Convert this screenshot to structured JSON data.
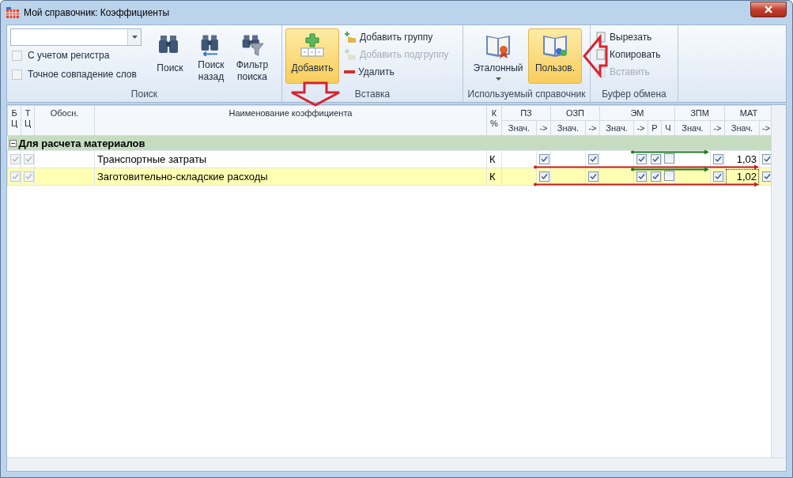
{
  "window": {
    "title": "Мой справочник: Коэффициенты"
  },
  "ribbon": {
    "search": {
      "label": "Поиск",
      "checkboxes": [
        {
          "label": "С учетом регистра",
          "checked": false
        },
        {
          "label": "Точное совпадение слов",
          "checked": false
        }
      ],
      "buttons": [
        {
          "kind": "search",
          "label": "Поиск"
        },
        {
          "kind": "back",
          "label": "Поиск назад"
        },
        {
          "kind": "filter",
          "label": "Фильтр поиска"
        }
      ]
    },
    "insert": {
      "label": "Вставка",
      "add": {
        "label": "Добавить",
        "selected": true
      },
      "items": [
        {
          "kind": "group",
          "label": "Добавить группу",
          "disabled": false
        },
        {
          "kind": "subgroup",
          "label": "Добавить подгруппу",
          "disabled": true
        },
        {
          "kind": "delete",
          "label": "Удалить",
          "disabled": false
        }
      ]
    },
    "reference": {
      "label": "Используемый справочник",
      "buttons": [
        {
          "kind": "standard",
          "label": "Эталонный",
          "selected": false,
          "dropdown": true
        },
        {
          "kind": "user",
          "label": "Пользов.",
          "selected": true,
          "dropdown": false
        }
      ]
    },
    "clipboard": {
      "label": "Буфер обмена",
      "items": [
        {
          "label": "Вырезать",
          "disabled": false
        },
        {
          "label": "Копировать",
          "disabled": false
        },
        {
          "label": "Вставить",
          "disabled": true
        }
      ]
    }
  },
  "grid": {
    "columns": [
      {
        "label": "Б Ц"
      },
      {
        "label": "Т Ц"
      },
      {
        "label": "Обосн."
      },
      {
        "label": "Наименование коэффициента"
      },
      {
        "label": "К %"
      }
    ],
    "groups": [
      {
        "label": "ПЗ",
        "sub": [
          "Знач.",
          "->"
        ]
      },
      {
        "label": "ОЗП",
        "sub": [
          "Знач.",
          "->"
        ]
      },
      {
        "label": "ЭМ",
        "sub": [
          "Знач.",
          "->",
          "Р",
          "Ч"
        ]
      },
      {
        "label": "ЗПМ",
        "sub": [
          "Знач.",
          "->"
        ]
      },
      {
        "label": "МАТ",
        "sub": [
          "Знач.",
          "->"
        ]
      }
    ],
    "sections": [
      {
        "label": "Для расчета материалов",
        "expanded": true,
        "rows": [
          {
            "selected": false,
            "bc": true,
            "tc": true,
            "name": "Транспортные затраты",
            "unit": "К",
            "cells": [
              {
                "kind": "value"
              },
              {
                "kind": "check",
                "checked": true
              },
              {
                "kind": "value"
              },
              {
                "kind": "check",
                "checked": true
              },
              {
                "kind": "value"
              },
              {
                "kind": "check",
                "checked": true
              },
              {
                "kind": "check",
                "checked": true
              },
              {
                "kind": "check",
                "checked": false
              },
              {
                "kind": "value"
              },
              {
                "kind": "check",
                "checked": true
              },
              {
                "kind": "value",
                "text": "1,03",
                "focused": false
              },
              {
                "kind": "check",
                "checked": true
              }
            ]
          },
          {
            "selected": true,
            "bc": true,
            "tc": true,
            "name": "Заготовительно-складские расходы",
            "unit": "К",
            "cells": [
              {
                "kind": "value"
              },
              {
                "kind": "check",
                "checked": true
              },
              {
                "kind": "value"
              },
              {
                "kind": "check",
                "checked": true
              },
              {
                "kind": "value"
              },
              {
                "kind": "check",
                "checked": true
              },
              {
                "kind": "check",
                "checked": true
              },
              {
                "kind": "check",
                "checked": false
              },
              {
                "kind": "value"
              },
              {
                "kind": "check",
                "checked": true
              },
              {
                "kind": "value",
                "text": "1,02",
                "focused": true
              },
              {
                "kind": "check",
                "checked": true
              }
            ]
          }
        ]
      }
    ]
  }
}
